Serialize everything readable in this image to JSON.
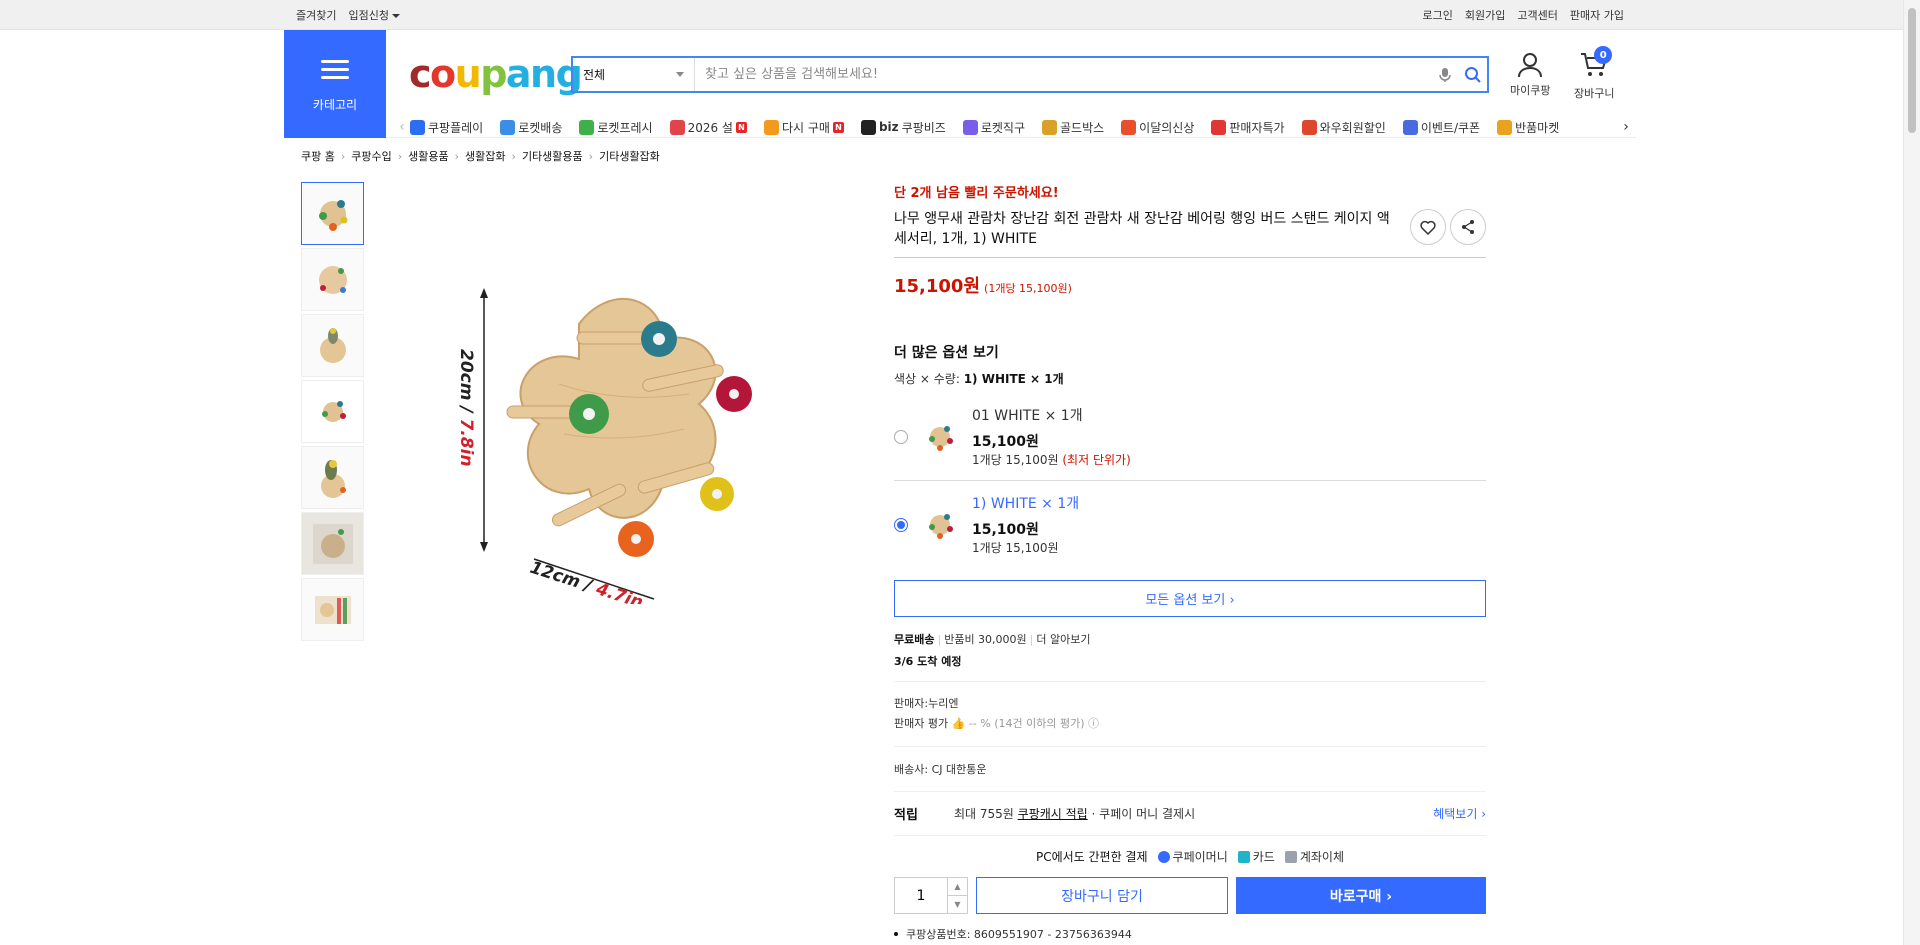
{
  "topbar": {
    "left": [
      "즐겨찾기",
      "입점신청"
    ],
    "right": [
      "로그인",
      "회원가입",
      "고객센터",
      "판매자 가입"
    ]
  },
  "header": {
    "category_label": "카테고리",
    "logo": "coupang",
    "search_category": "전체",
    "search_placeholder": "찾고 싶은 상품을 검색해보세요!",
    "my_label": "마이쿠팡",
    "cart_label": "장바구니",
    "cart_count": "0"
  },
  "shortcuts": [
    {
      "label": "쿠팡플레이",
      "color": "#2c6ef2"
    },
    {
      "label": "로켓배송",
      "color": "#3a8ee6"
    },
    {
      "label": "로켓프레시",
      "color": "#3fb14b"
    },
    {
      "label": "2026 설",
      "color": "#e0454a",
      "badge": "N"
    },
    {
      "label": "다시 구매",
      "color": "#f39a1e",
      "badge": "N"
    },
    {
      "label": "쿠팡비즈",
      "color": "#222222",
      "prefix": "biz"
    },
    {
      "label": "로켓직구",
      "color": "#7a5de8"
    },
    {
      "label": "골드박스",
      "color": "#d9a12a"
    },
    {
      "label": "이달의신상",
      "color": "#e8502d"
    },
    {
      "label": "판매자특가",
      "color": "#e03636"
    },
    {
      "label": "와우회원할인",
      "color": "#e0452d"
    },
    {
      "label": "이벤트/쿠폰",
      "color": "#4a6be0"
    },
    {
      "label": "반품마켓",
      "color": "#e8a21e"
    }
  ],
  "breadcrumb": [
    "쿠팡 홈",
    "쿠팡수입",
    "생활용품",
    "생활잡화",
    "기타생활용품",
    "기타생활잡화"
  ],
  "product": {
    "urgent": "단 2개 남음 빨리 주문하세요!",
    "title": "나무 앵무새 관람차 장난감 회전 관람차 새 장난감 베어링 행잉 버드 스탠드 케이지 액세서리, 1개, 1) WHITE",
    "price": "15,100원",
    "unit_price": "(1개당 15,100원)",
    "image_label_height": "20cm / ",
    "image_label_height_in": "7.8in",
    "image_label_width": "12cm / ",
    "image_label_width_in": "4.7in"
  },
  "options": {
    "heading": "더 많은 옵션 보기",
    "current_label": "색상 × 수량: ",
    "current_value": "1) WHITE × 1개",
    "items": [
      {
        "name": "01 WHITE × 1개",
        "price": "15,100원",
        "unit": "1개당 15,100원",
        "note": " (최저 단위가)",
        "selected": false
      },
      {
        "name": "1) WHITE × 1개",
        "price": "15,100원",
        "unit": "1개당 15,100원",
        "note": "",
        "selected": true
      }
    ],
    "all_button": "모든 옵션 보기 ›"
  },
  "shipping": {
    "free": "무료배송",
    "return_fee": "반품비 30,000원",
    "more": "더 알아보기",
    "arrival": "3/6 도착 예정"
  },
  "seller": {
    "name_label": "판매자:",
    "name": "누리엔",
    "rating_label": "판매자 평가",
    "rating_value": "-- % (14건 이하의 평가)"
  },
  "carrier": {
    "label": "배송사:",
    "name": "CJ 대한통운"
  },
  "reward": {
    "label": "적립",
    "prefix": "최대 755원 ",
    "link": "쿠팡캐시 적립",
    "suffix": " · 쿠페이 머니 결제시",
    "benefit": "혜택보기 ›"
  },
  "payment": {
    "lead": "PC에서도 간편한 결제",
    "methods": [
      {
        "label": "쿠페이머니",
        "color": "#346aff"
      },
      {
        "label": "카드",
        "color": "#1fb4c8"
      },
      {
        "label": "계좌이체",
        "color": "#9aa3ad"
      }
    ]
  },
  "purchase": {
    "quantity": "1",
    "cart_button": "장바구니 담기",
    "buy_button": "바로구매 ›"
  },
  "product_number": "쿠팡상품번호: 8609551907 - 23756363944"
}
